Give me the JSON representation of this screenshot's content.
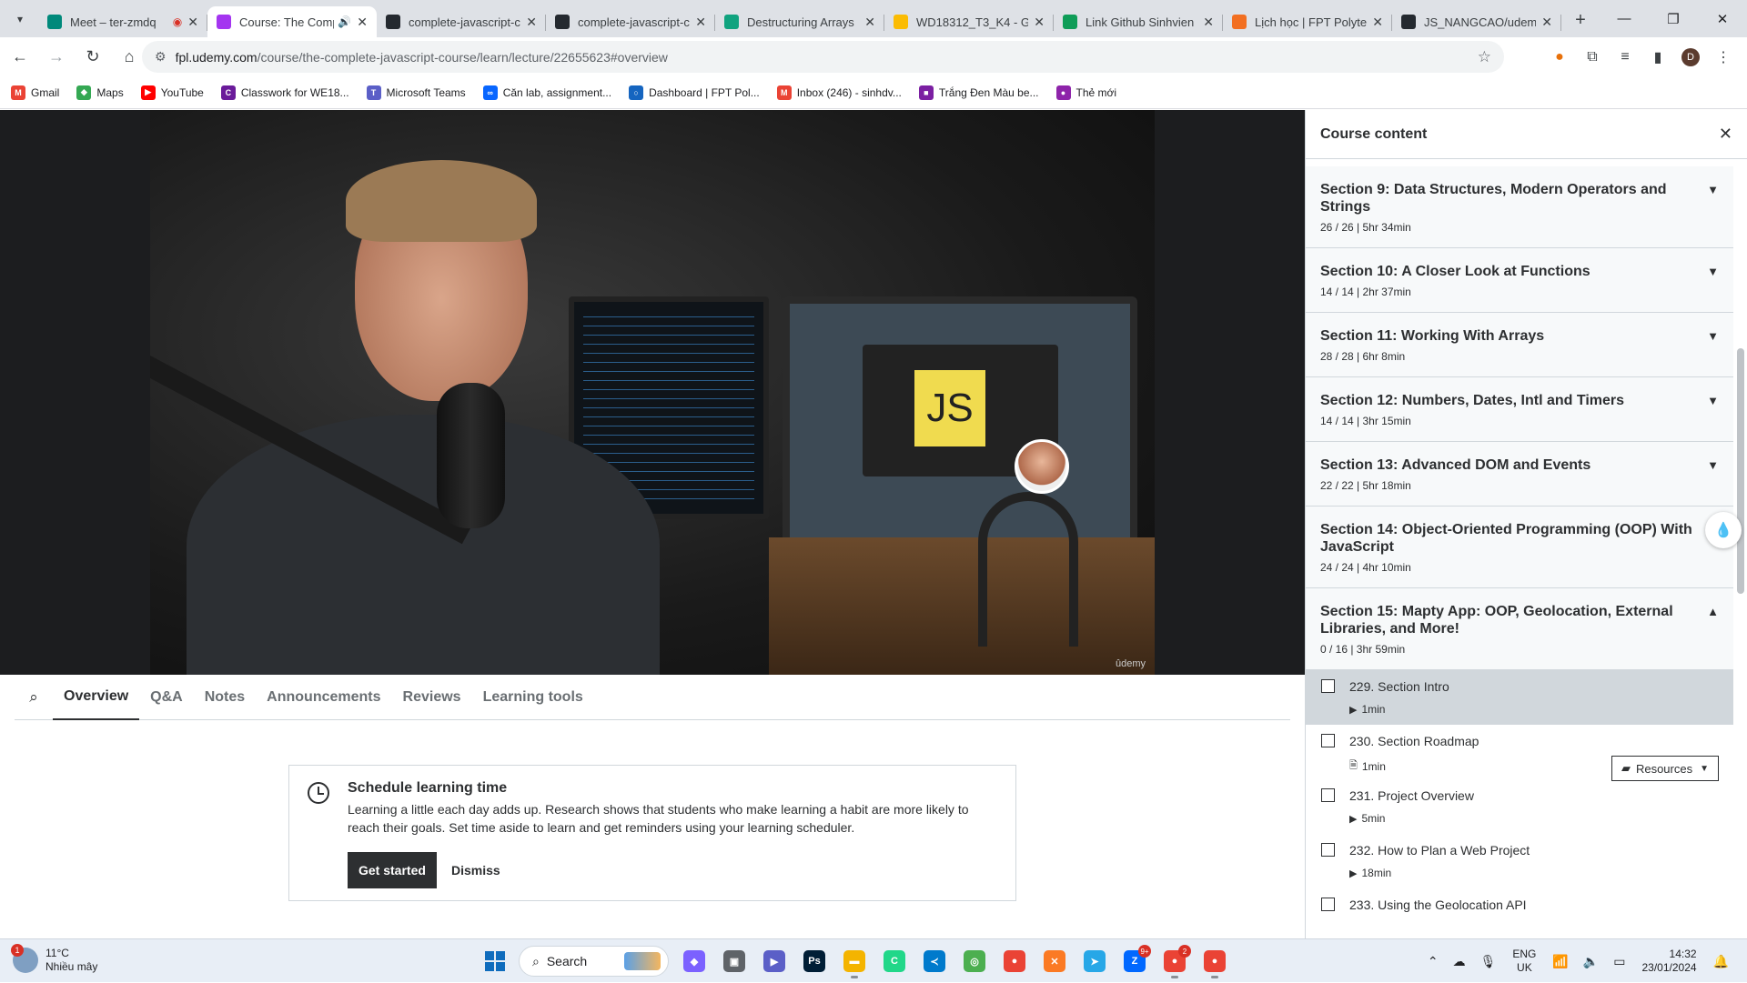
{
  "browser": {
    "tabs": [
      {
        "title": "Meet – ter-zmdq",
        "icon": "google-meet-icon",
        "color": "#00897b",
        "extra": "recording-icon",
        "active": false
      },
      {
        "title": "Course: The Comp",
        "icon": "udemy-icon",
        "color": "#a435f0",
        "extra": "speaker-icon",
        "active": true
      },
      {
        "title": "complete-javascript-c",
        "icon": "github-icon",
        "color": "#24292f",
        "active": false
      },
      {
        "title": "complete-javascript-c",
        "icon": "github-icon",
        "color": "#24292f",
        "active": false
      },
      {
        "title": "Destructuring Arrays",
        "icon": "chatgpt-icon",
        "color": "#10a37f",
        "active": false
      },
      {
        "title": "WD18312_T3_K4 - Go",
        "icon": "google-drive-icon",
        "color": "#fbbc04",
        "active": false
      },
      {
        "title": "Link Github Sinhvien",
        "icon": "google-sheets-icon",
        "color": "#0f9d58",
        "active": false
      },
      {
        "title": "Lịch học | FPT Polytec",
        "icon": "fpt-icon",
        "color": "#f26f21",
        "active": false
      },
      {
        "title": "JS_NANGCAO/udemy",
        "icon": "github-icon",
        "color": "#24292f",
        "active": false
      }
    ],
    "url_domain": "fpl.udemy.com",
    "url_path": "/course/the-complete-javascript-course/learn/lecture/22655623#overview",
    "profile_initial": "D",
    "bookmarks": [
      {
        "label": "Gmail",
        "icon": "gmail-icon",
        "color": "#ea4335",
        "glyph": "M"
      },
      {
        "label": "Maps",
        "icon": "maps-icon",
        "color": "#34a853",
        "glyph": "◆"
      },
      {
        "label": "YouTube",
        "icon": "youtube-icon",
        "color": "#ff0000",
        "glyph": "▶"
      },
      {
        "label": "Classwork for WE18...",
        "icon": "classroom-icon",
        "color": "#6a1b9a",
        "glyph": "C"
      },
      {
        "label": "Microsoft Teams",
        "icon": "teams-icon",
        "color": "#5b5fc7",
        "glyph": "T"
      },
      {
        "label": "Căn lab, assignment...",
        "icon": "meta-icon",
        "color": "#0866ff",
        "glyph": "∞"
      },
      {
        "label": "Dashboard | FPT Pol...",
        "icon": "circle-icon",
        "color": "#1565c0",
        "glyph": "○"
      },
      {
        "label": "Inbox (246) - sinhdv...",
        "icon": "gmail-icon",
        "color": "#ea4335",
        "glyph": "M"
      },
      {
        "label": "Trắng Đen Màu be...",
        "icon": "bookmark-image-icon",
        "color": "#7b1fa2",
        "glyph": "■"
      },
      {
        "label": "Thẻ mới",
        "icon": "new-tab-icon",
        "color": "#8e24aa",
        "glyph": "●"
      }
    ]
  },
  "video": {
    "watermark": "ûdemy",
    "screen_text": "JS"
  },
  "lecture_tabs": [
    "Overview",
    "Q&A",
    "Notes",
    "Announcements",
    "Reviews",
    "Learning tools"
  ],
  "active_lecture_tab": "Overview",
  "schedule_card": {
    "title": "Schedule learning time",
    "body": "Learning a little each day adds up. Research shows that students who make learning a habit are more likely to reach their goals. Set time aside to learn and get reminders using your learning scheduler.",
    "primary": "Get started",
    "secondary": "Dismiss"
  },
  "sidebar": {
    "title": "Course content",
    "sections": [
      {
        "title": "Section 9: Data Structures, Modern Operators and Strings",
        "meta": "26 / 26 | 5hr 34min",
        "expanded": false
      },
      {
        "title": "Section 10: A Closer Look at Functions",
        "meta": "14 / 14 | 2hr 37min",
        "expanded": false
      },
      {
        "title": "Section 11: Working With Arrays",
        "meta": "28 / 28 | 6hr 8min",
        "expanded": false
      },
      {
        "title": "Section 12: Numbers, Dates, Intl and Timers",
        "meta": "14 / 14 | 3hr 15min",
        "expanded": false
      },
      {
        "title": "Section 13: Advanced DOM and Events",
        "meta": "22 / 22 | 5hr 18min",
        "expanded": false
      },
      {
        "title": "Section 14: Object-Oriented Programming (OOP) With JavaScript",
        "meta": "24 / 24 | 4hr 10min",
        "expanded": false
      },
      {
        "title": "Section 15: Mapty App: OOP, Geolocation, External Libraries, and More!",
        "meta": "0 / 16 | 3hr 59min",
        "expanded": true
      }
    ],
    "lectures": [
      {
        "title": "229. Section Intro",
        "duration": "1min",
        "type": "video-icon",
        "current": true
      },
      {
        "title": "230. Section Roadmap",
        "duration": "1min",
        "type": "file-icon",
        "current": false,
        "resources": "Resources"
      },
      {
        "title": "231. Project Overview",
        "duration": "5min",
        "type": "video-icon",
        "current": false
      },
      {
        "title": "232. How to Plan a Web Project",
        "duration": "18min",
        "type": "video-icon",
        "current": false
      },
      {
        "title": "233. Using the Geolocation API",
        "duration": "",
        "type": "video-icon",
        "current": false
      }
    ]
  },
  "taskbar": {
    "weather_temp": "11°C",
    "weather_desc": "Nhiều mây",
    "weather_badge": "1",
    "search_label": "Search",
    "apps": [
      {
        "name": "copilot-app-icon",
        "color": "#7b61ff",
        "glyph": "◆"
      },
      {
        "name": "task-view-icon",
        "color": "#5f6368",
        "glyph": "▣"
      },
      {
        "name": "teams-chat-icon",
        "color": "#5b5fc7",
        "glyph": "▶"
      },
      {
        "name": "photoshop-icon",
        "color": "#001e36",
        "glyph": "Ps"
      },
      {
        "name": "file-explorer-icon",
        "color": "#f4b400",
        "glyph": "▬",
        "open": true
      },
      {
        "name": "pycharm-icon",
        "color": "#21d789",
        "glyph": "C"
      },
      {
        "name": "vscode-icon",
        "color": "#007acc",
        "glyph": "≺"
      },
      {
        "name": "eclipse-icon",
        "color": "#4caf50",
        "glyph": "◎"
      },
      {
        "name": "chrome-icon",
        "color": "#ea4335",
        "glyph": "●"
      },
      {
        "name": "xampp-icon",
        "color": "#fb7a24",
        "glyph": "✕"
      },
      {
        "name": "telegram-icon",
        "color": "#27a7e7",
        "glyph": "➤"
      },
      {
        "name": "zalo-icon",
        "color": "#0068ff",
        "glyph": "Z",
        "badge": "9+"
      },
      {
        "name": "chrome-profile-icon",
        "color": "#ea4335",
        "glyph": "●",
        "badge": "2",
        "open": true
      },
      {
        "name": "chrome-active-icon",
        "color": "#ea4335",
        "glyph": "●",
        "open": true
      }
    ],
    "lang_top": "ENG",
    "lang_bottom": "UK",
    "time": "14:32",
    "date": "23/01/2024"
  }
}
